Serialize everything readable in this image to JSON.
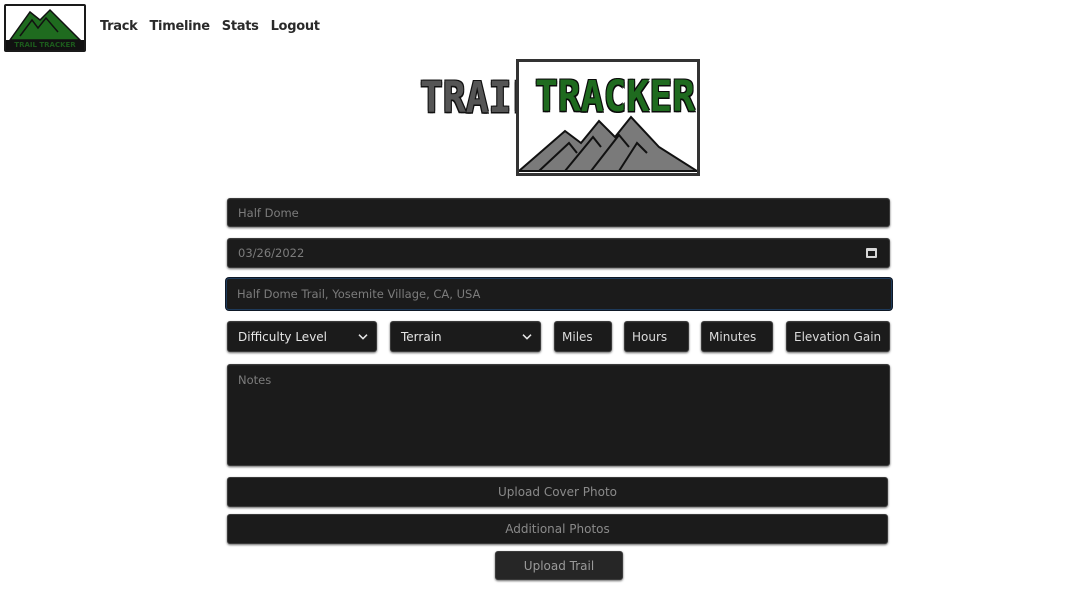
{
  "nav": {
    "logo_text": "TRAIL TRACKER",
    "links": [
      {
        "label": "Track"
      },
      {
        "label": "Timeline"
      },
      {
        "label": "Stats"
      },
      {
        "label": "Logout"
      }
    ]
  },
  "brand": {
    "word_left": "TRAIL",
    "word_right": "TRACKER",
    "colors": {
      "accent": "#1f6b1f",
      "mountain": "#7a7a7a"
    }
  },
  "form": {
    "trail_name": {
      "value": "Half Dome"
    },
    "date": {
      "value": "03/26/2022"
    },
    "location": {
      "value": "Half Dome Trail, Yosemite Village, CA, USA"
    },
    "difficulty": {
      "selected": "Difficulty Level"
    },
    "terrain": {
      "selected": "Terrain"
    },
    "miles": {
      "placeholder": "Miles"
    },
    "hours": {
      "placeholder": "Hours"
    },
    "minutes": {
      "placeholder": "Minutes"
    },
    "elevation_gain": {
      "placeholder": "Elevation Gain"
    },
    "notes": {
      "placeholder": "Notes"
    },
    "upload_cover_photo_label": "Upload Cover Photo",
    "additional_photos_label": "Additional Photos",
    "submit_label": "Upload Trail"
  },
  "colors": {
    "field_bg": "#1b1b1b",
    "page_bg": "#ffffff"
  }
}
